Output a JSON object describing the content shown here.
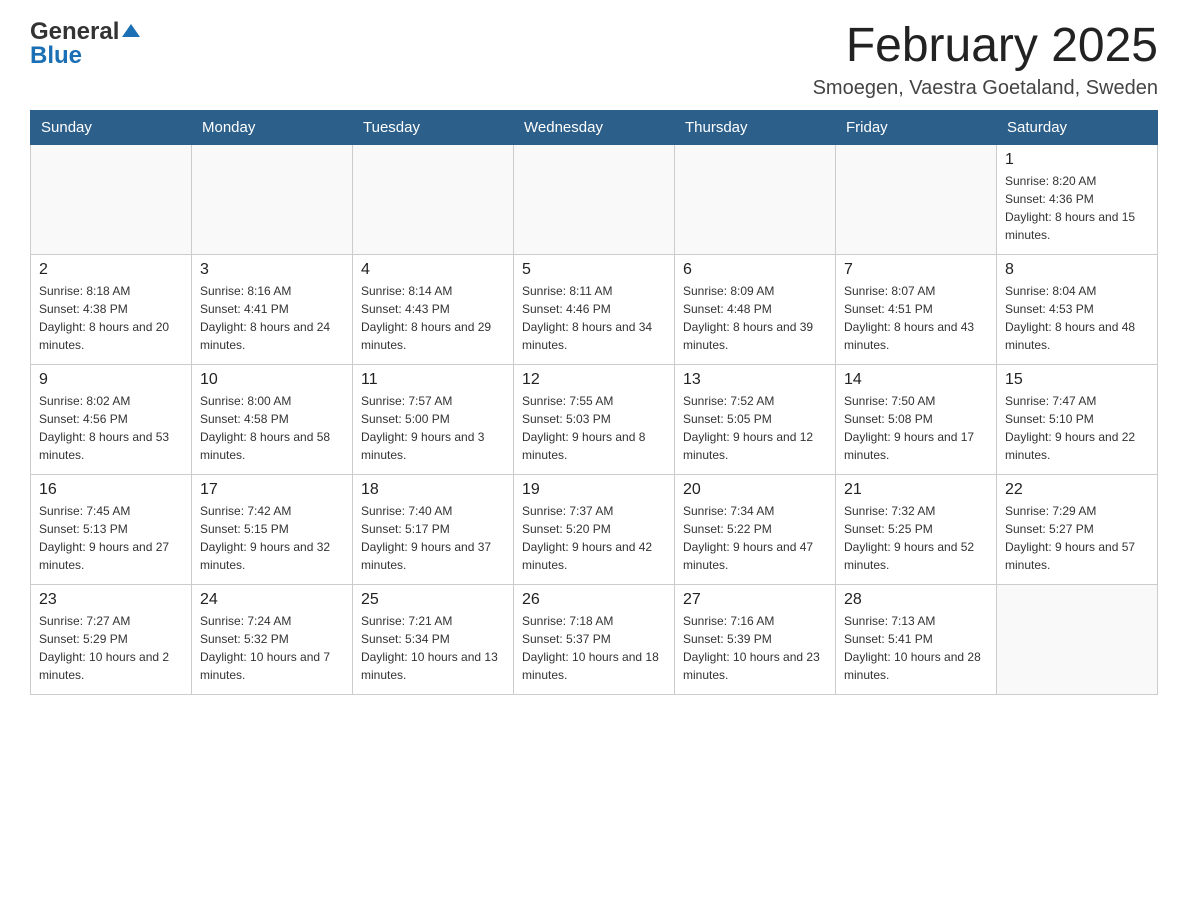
{
  "header": {
    "logo_general": "General",
    "logo_triangle": "",
    "logo_blue": "Blue",
    "month_title": "February 2025",
    "location": "Smoegen, Vaestra Goetaland, Sweden"
  },
  "weekdays": [
    "Sunday",
    "Monday",
    "Tuesday",
    "Wednesday",
    "Thursday",
    "Friday",
    "Saturday"
  ],
  "weeks": [
    [
      {
        "day": "",
        "sunrise": "",
        "sunset": "",
        "daylight": ""
      },
      {
        "day": "",
        "sunrise": "",
        "sunset": "",
        "daylight": ""
      },
      {
        "day": "",
        "sunrise": "",
        "sunset": "",
        "daylight": ""
      },
      {
        "day": "",
        "sunrise": "",
        "sunset": "",
        "daylight": ""
      },
      {
        "day": "",
        "sunrise": "",
        "sunset": "",
        "daylight": ""
      },
      {
        "day": "",
        "sunrise": "",
        "sunset": "",
        "daylight": ""
      },
      {
        "day": "1",
        "sunrise": "Sunrise: 8:20 AM",
        "sunset": "Sunset: 4:36 PM",
        "daylight": "Daylight: 8 hours and 15 minutes."
      }
    ],
    [
      {
        "day": "2",
        "sunrise": "Sunrise: 8:18 AM",
        "sunset": "Sunset: 4:38 PM",
        "daylight": "Daylight: 8 hours and 20 minutes."
      },
      {
        "day": "3",
        "sunrise": "Sunrise: 8:16 AM",
        "sunset": "Sunset: 4:41 PM",
        "daylight": "Daylight: 8 hours and 24 minutes."
      },
      {
        "day": "4",
        "sunrise": "Sunrise: 8:14 AM",
        "sunset": "Sunset: 4:43 PM",
        "daylight": "Daylight: 8 hours and 29 minutes."
      },
      {
        "day": "5",
        "sunrise": "Sunrise: 8:11 AM",
        "sunset": "Sunset: 4:46 PM",
        "daylight": "Daylight: 8 hours and 34 minutes."
      },
      {
        "day": "6",
        "sunrise": "Sunrise: 8:09 AM",
        "sunset": "Sunset: 4:48 PM",
        "daylight": "Daylight: 8 hours and 39 minutes."
      },
      {
        "day": "7",
        "sunrise": "Sunrise: 8:07 AM",
        "sunset": "Sunset: 4:51 PM",
        "daylight": "Daylight: 8 hours and 43 minutes."
      },
      {
        "day": "8",
        "sunrise": "Sunrise: 8:04 AM",
        "sunset": "Sunset: 4:53 PM",
        "daylight": "Daylight: 8 hours and 48 minutes."
      }
    ],
    [
      {
        "day": "9",
        "sunrise": "Sunrise: 8:02 AM",
        "sunset": "Sunset: 4:56 PM",
        "daylight": "Daylight: 8 hours and 53 minutes."
      },
      {
        "day": "10",
        "sunrise": "Sunrise: 8:00 AM",
        "sunset": "Sunset: 4:58 PM",
        "daylight": "Daylight: 8 hours and 58 minutes."
      },
      {
        "day": "11",
        "sunrise": "Sunrise: 7:57 AM",
        "sunset": "Sunset: 5:00 PM",
        "daylight": "Daylight: 9 hours and 3 minutes."
      },
      {
        "day": "12",
        "sunrise": "Sunrise: 7:55 AM",
        "sunset": "Sunset: 5:03 PM",
        "daylight": "Daylight: 9 hours and 8 minutes."
      },
      {
        "day": "13",
        "sunrise": "Sunrise: 7:52 AM",
        "sunset": "Sunset: 5:05 PM",
        "daylight": "Daylight: 9 hours and 12 minutes."
      },
      {
        "day": "14",
        "sunrise": "Sunrise: 7:50 AM",
        "sunset": "Sunset: 5:08 PM",
        "daylight": "Daylight: 9 hours and 17 minutes."
      },
      {
        "day": "15",
        "sunrise": "Sunrise: 7:47 AM",
        "sunset": "Sunset: 5:10 PM",
        "daylight": "Daylight: 9 hours and 22 minutes."
      }
    ],
    [
      {
        "day": "16",
        "sunrise": "Sunrise: 7:45 AM",
        "sunset": "Sunset: 5:13 PM",
        "daylight": "Daylight: 9 hours and 27 minutes."
      },
      {
        "day": "17",
        "sunrise": "Sunrise: 7:42 AM",
        "sunset": "Sunset: 5:15 PM",
        "daylight": "Daylight: 9 hours and 32 minutes."
      },
      {
        "day": "18",
        "sunrise": "Sunrise: 7:40 AM",
        "sunset": "Sunset: 5:17 PM",
        "daylight": "Daylight: 9 hours and 37 minutes."
      },
      {
        "day": "19",
        "sunrise": "Sunrise: 7:37 AM",
        "sunset": "Sunset: 5:20 PM",
        "daylight": "Daylight: 9 hours and 42 minutes."
      },
      {
        "day": "20",
        "sunrise": "Sunrise: 7:34 AM",
        "sunset": "Sunset: 5:22 PM",
        "daylight": "Daylight: 9 hours and 47 minutes."
      },
      {
        "day": "21",
        "sunrise": "Sunrise: 7:32 AM",
        "sunset": "Sunset: 5:25 PM",
        "daylight": "Daylight: 9 hours and 52 minutes."
      },
      {
        "day": "22",
        "sunrise": "Sunrise: 7:29 AM",
        "sunset": "Sunset: 5:27 PM",
        "daylight": "Daylight: 9 hours and 57 minutes."
      }
    ],
    [
      {
        "day": "23",
        "sunrise": "Sunrise: 7:27 AM",
        "sunset": "Sunset: 5:29 PM",
        "daylight": "Daylight: 10 hours and 2 minutes."
      },
      {
        "day": "24",
        "sunrise": "Sunrise: 7:24 AM",
        "sunset": "Sunset: 5:32 PM",
        "daylight": "Daylight: 10 hours and 7 minutes."
      },
      {
        "day": "25",
        "sunrise": "Sunrise: 7:21 AM",
        "sunset": "Sunset: 5:34 PM",
        "daylight": "Daylight: 10 hours and 13 minutes."
      },
      {
        "day": "26",
        "sunrise": "Sunrise: 7:18 AM",
        "sunset": "Sunset: 5:37 PM",
        "daylight": "Daylight: 10 hours and 18 minutes."
      },
      {
        "day": "27",
        "sunrise": "Sunrise: 7:16 AM",
        "sunset": "Sunset: 5:39 PM",
        "daylight": "Daylight: 10 hours and 23 minutes."
      },
      {
        "day": "28",
        "sunrise": "Sunrise: 7:13 AM",
        "sunset": "Sunset: 5:41 PM",
        "daylight": "Daylight: 10 hours and 28 minutes."
      },
      {
        "day": "",
        "sunrise": "",
        "sunset": "",
        "daylight": ""
      }
    ]
  ]
}
